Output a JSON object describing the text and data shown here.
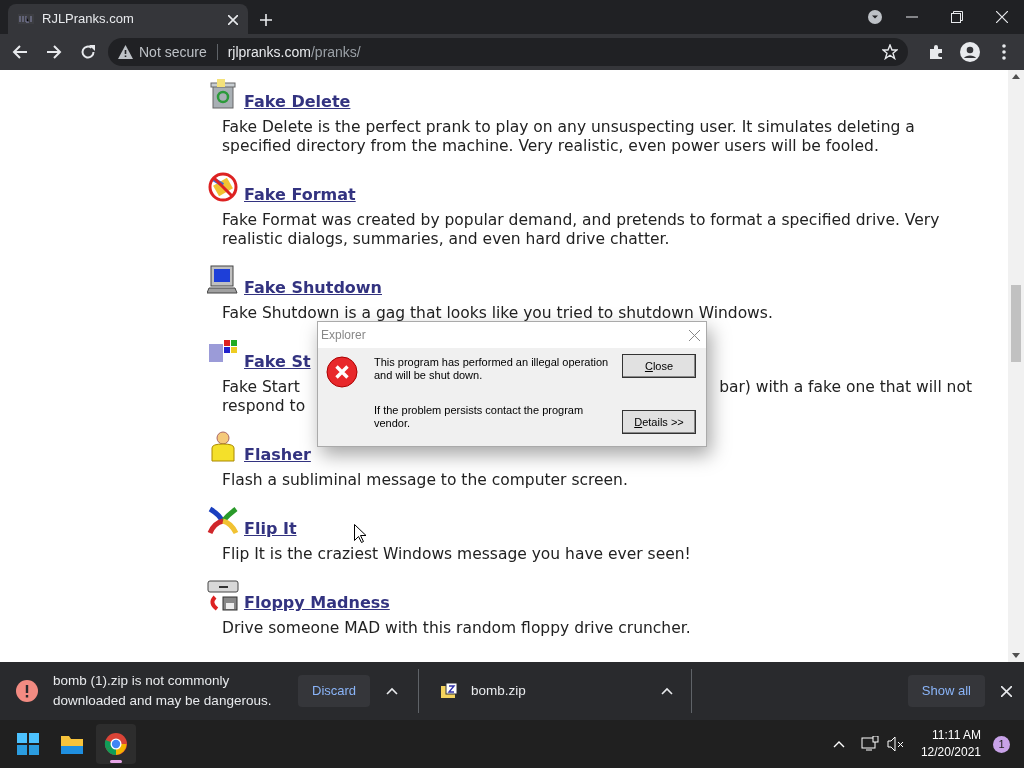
{
  "browser": {
    "tab": {
      "title": "RJLPranks.com",
      "selected": true
    },
    "address": {
      "security": "Not secure",
      "host": "rjlpranks.com",
      "path": "/pranks/"
    }
  },
  "pranks": [
    {
      "title": "Fake Delete",
      "description": "Fake Delete is the perfect prank to play on any unsuspecting user. It simulates deleting a specified directory from the machine. Very realistic, even power users will be fooled."
    },
    {
      "title": "Fake Format",
      "description": "Fake Format was created by popular demand, and pretends to format a specified drive. Very realistic dialogs, summaries, and even hard drive chatter."
    },
    {
      "title": "Fake Shutdown",
      "description": "Fake Shutdown is a gag that looks like you tried to shutdown Windows."
    },
    {
      "title": "Fake St",
      "description_fragments": [
        [
          "Fake Start",
          "bar) with a fake one that will not"
        ],
        [
          "respond to"
        ]
      ]
    },
    {
      "title": "Flasher",
      "description": "Flash a subliminal message to the computer screen."
    },
    {
      "title": "Flip It",
      "description": "Flip It is the craziest Windows message you have ever seen!"
    },
    {
      "title": "Floppy Madness",
      "description": "Drive someone MAD with this random floppy drive cruncher."
    }
  ],
  "dialog": {
    "title": "Explorer",
    "messages": [
      "This program has performed an illegal operation and will be shut down.",
      "If the problem persists contact the program vendor."
    ],
    "buttons": [
      "Close",
      "Details >>"
    ]
  },
  "downloads": {
    "warning": {
      "text": "bomb (1).zip is not commonly downloaded and may be dangerous.",
      "button": "Discard"
    },
    "file": {
      "name": "bomb.zip"
    },
    "show_all": "Show all"
  },
  "taskbar": {
    "apps": [
      {
        "kind": "start",
        "active": false
      },
      {
        "kind": "folder",
        "active": false
      },
      {
        "kind": "chrome",
        "active": true
      }
    ],
    "time": "11:11 AM",
    "date": "12/20/2021",
    "notifications": "1"
  }
}
